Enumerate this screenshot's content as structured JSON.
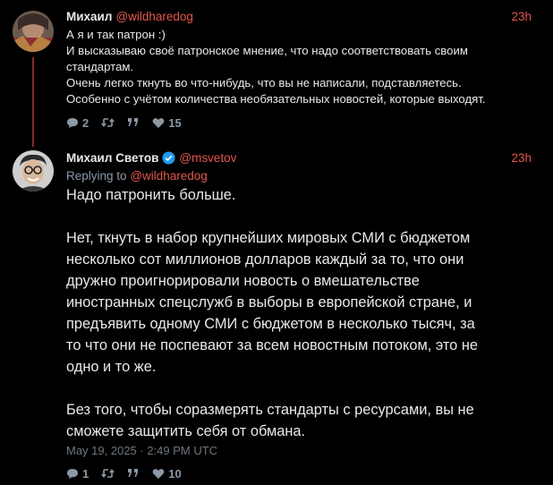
{
  "tweet1": {
    "author_name": "Михаил",
    "author_handle": "@wildharedog",
    "time": "23h",
    "lines": [
      "А я и так патрон :)",
      "И высказываю своё патронское мнение, что надо соответствовать своим",
      "стандартам.",
      "Очень легко ткнуть во что-нибудь, что вы не написали, подставляетесь.",
      "Особенно с учётом количества необязательных новостей, которые выходят."
    ],
    "reply_count": "2",
    "like_count": "15"
  },
  "tweet2": {
    "author_name": "Михаил Светов",
    "author_handle": "@msvetov",
    "time": "23h",
    "replying_prefix": "Replying to",
    "replying_handle": "@wildharedog",
    "paragraph1": [
      "Надо патронить больше."
    ],
    "paragraph2": [
      "Нет, ткнуть в набор крупнейших мировых СМИ с бюджетом",
      "несколько сот миллионов долларов каждый за то, что они",
      "дружно проигнорировали новость о вмешательстве",
      "иностранных спецслужб в выборы в европейской стране, и",
      "предъявить одному СМИ с бюджетом в несколько тысяч, за",
      "то что они не поспевают за всем новостным потоком, это не",
      "одно и то же."
    ],
    "paragraph3": [
      "Без того, чтобы соразмерять стандарты с ресурсами, вы не",
      "сможете защитить себя от обмана."
    ],
    "timestamp": "May 19, 2025 · 2:49 PM UTC",
    "reply_count": "1",
    "like_count": "10"
  },
  "icons": {
    "reply": "comment-icon",
    "retweet": "retweet-icon",
    "quote": "quote-icon",
    "like": "heart-icon",
    "verified": "verified-badge-icon"
  },
  "colors": {
    "background": "#000000",
    "accent": "#e2574c",
    "muted": "#8b98a5",
    "verified": "#1d9bf0"
  }
}
